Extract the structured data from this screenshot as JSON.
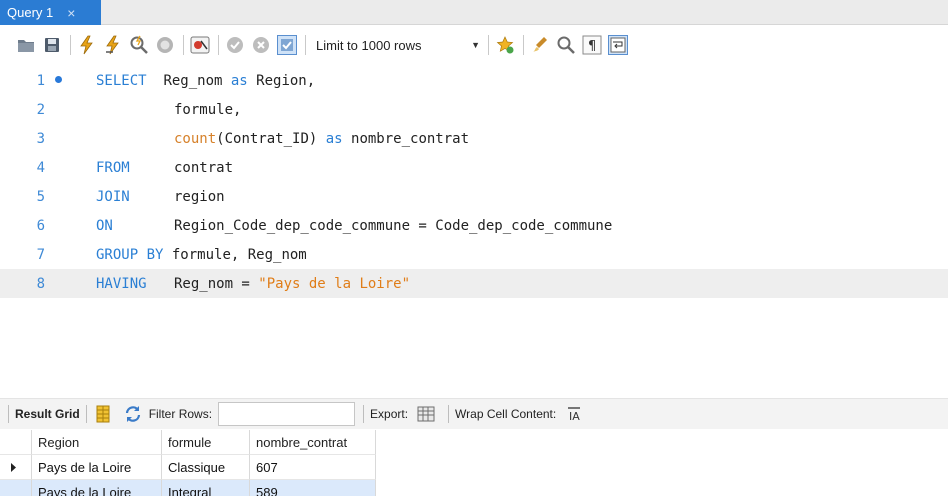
{
  "tab": {
    "title": "Query 1",
    "close_glyph": "×"
  },
  "toolbar": {
    "icons": [
      "open-folder-icon",
      "save-icon",
      "execute-icon",
      "execute-current-icon",
      "explain-icon",
      "stop-icon",
      "toggle-error-icon",
      "commit-icon",
      "rollback-icon",
      "autocommit-icon"
    ],
    "limit_label": "Limit to 1000 rows",
    "right_icons": [
      "bookmark-icon",
      "beautify-icon",
      "find-icon",
      "invisible-chars-icon",
      "wrap-icon"
    ]
  },
  "editor": {
    "lines": [
      {
        "no": "1",
        "has_dot": true
      },
      {
        "no": "2"
      },
      {
        "no": "3"
      },
      {
        "no": "4"
      },
      {
        "no": "5"
      },
      {
        "no": "6"
      },
      {
        "no": "7"
      },
      {
        "no": "8",
        "current": true
      }
    ],
    "tokens": {
      "l1_kw": "SELECT",
      "l1_a": "Reg_nom ",
      "l1_as": "as",
      "l1_b": " Region,",
      "l2": "formule,",
      "l3_fn": "count",
      "l3_a": "(Contrat_ID) ",
      "l3_as": "as",
      "l3_b": " nombre_contrat",
      "l4_kw": "FROM",
      "l4_a": "contrat",
      "l5_kw": "JOIN",
      "l5_a": "region",
      "l6_kw": "ON",
      "l6_a": "Region_Code_dep_code_commune = Code_dep_code_commune",
      "l7_kw": "GROUP BY",
      "l7_a": " formule, Reg_nom",
      "l8_kw": "HAVING",
      "l8_a": "Reg_nom = ",
      "l8_str": "\"Pays de la Loire\""
    }
  },
  "resultbar": {
    "result_grid": "Result Grid",
    "filter_rows": "Filter Rows:",
    "export": "Export:",
    "wrap_cell": "Wrap Cell Content:"
  },
  "grid": {
    "columns": [
      "Region",
      "formule",
      "nombre_contrat"
    ],
    "rows": [
      [
        "Pays de la Loire",
        "Classique",
        "607"
      ],
      [
        "Pays de la Loire",
        "Integral",
        "589"
      ]
    ]
  },
  "colors": {
    "accent": "#2b7cd3",
    "keyword": "#2a7fd4",
    "string": "#e07d18",
    "selection": "#dbe9fb"
  }
}
